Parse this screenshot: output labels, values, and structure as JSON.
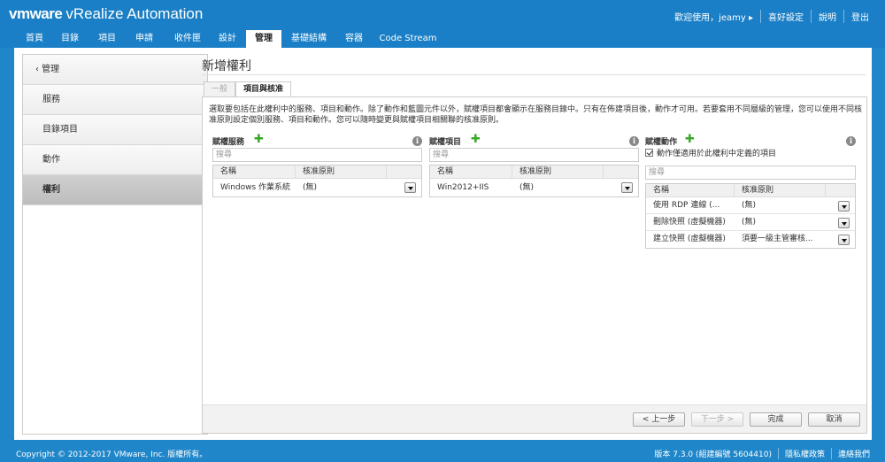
{
  "header": {
    "brand_vm": "vmware",
    "brand_product": "vRealize Automation",
    "links": [
      "歡迎使用，jeamy ▸",
      "喜好設定",
      "說明",
      "登出"
    ]
  },
  "nav": {
    "tabs": [
      "首頁",
      "目錄",
      "項目",
      "申請",
      "收件匣",
      "設計",
      "管理",
      "基礎結構",
      "容器",
      "Code Stream"
    ],
    "active": "管理"
  },
  "sidebar": {
    "back": "‹ 管理",
    "items": [
      "服務",
      "目錄項目",
      "動作",
      "權利"
    ],
    "active": "權利"
  },
  "page": {
    "title": "新增權利",
    "tabs": [
      "一般",
      "項目與核准"
    ],
    "active_tab": "項目與核准",
    "description": "選取要包括在此權利中的服務、項目和動作。除了動作和藍圖元件以外，賦權項目都會顯示在服務目錄中。只有在佈建項目後，動作才可用。若要套用不同層級的管理，您可以使用不同核准原則設定個別服務、項目和動作。您可以隨時變更與賦權項目相關聯的核准原則。"
  },
  "services": {
    "title": "賦權服務",
    "search_placeholder": "搜尋",
    "columns": [
      "名稱",
      "核准原則"
    ],
    "rows": [
      {
        "name": "Windows 作業系統",
        "policy": "(無)"
      }
    ]
  },
  "items": {
    "title": "賦權項目",
    "search_placeholder": "搜尋",
    "columns": [
      "名稱",
      "核准原則"
    ],
    "rows": [
      {
        "name": "Win2012+IIS",
        "policy": "(無)"
      }
    ]
  },
  "actions": {
    "title": "賦權動作",
    "checkbox_label": "動作僅適用於此權利中定義的項目",
    "checkbox_checked": true,
    "search_placeholder": "搜尋",
    "columns": [
      "名稱",
      "核准原則"
    ],
    "rows": [
      {
        "name": "使用 RDP 連線 (...",
        "policy": "(無)"
      },
      {
        "name": "刪除快照 (虛擬機器)",
        "policy": "(無)"
      },
      {
        "name": "建立快照 (虛擬機器)",
        "policy": "須要一級主管審核..."
      }
    ]
  },
  "buttons": {
    "prev": "< 上一步",
    "next": "下一步 >",
    "finish": "完成",
    "cancel": "取消"
  },
  "footer": {
    "copyright": "Copyright © 2012-2017 VMware, Inc. 版權所有。",
    "links": [
      "版本 7.3.0 (組建編號 5604410)",
      "隱私權政策",
      "連絡我們"
    ]
  },
  "colors": {
    "header_blue": "#1a7fc6",
    "add_green": "#3aa829"
  }
}
